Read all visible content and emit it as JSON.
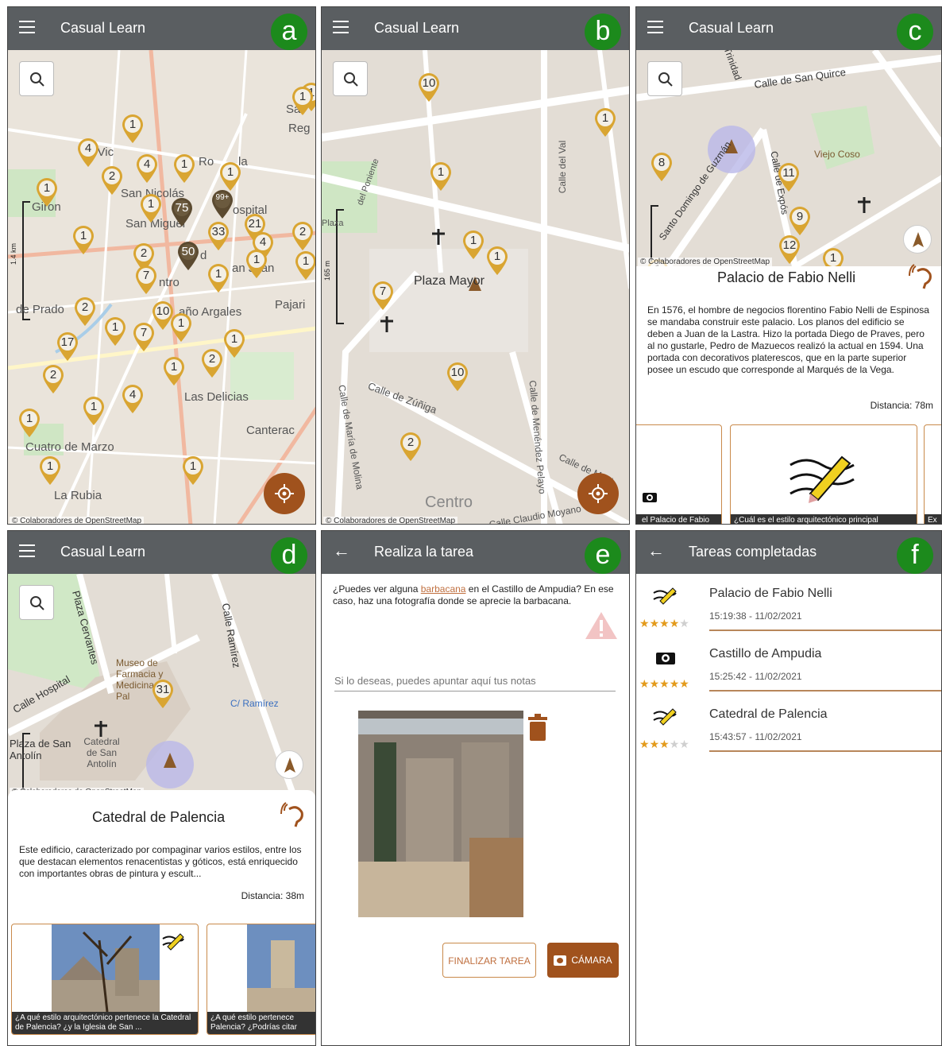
{
  "colors": {
    "appbar": "#5a5e61",
    "badge": "#1c8a1c",
    "accent": "#a0521d",
    "pin": "#d9a532",
    "pin_dark": "#5b4a30"
  },
  "panels": {
    "a": {
      "badge": "a",
      "app_title": "Casual Learn",
      "labels": [
        "Giron",
        "Sa",
        "Reg",
        "a Vic",
        "Ro",
        "la",
        "San Nicolás",
        "San Miguel",
        "ospital",
        "ntro",
        "de Prado",
        "año Argales",
        "Pajari",
        "Las Delicias",
        "Canterac",
        "Cuatro de Marzo",
        "La Rubia",
        "d",
        "an Juan"
      ],
      "pins": [
        "1",
        "4",
        "1",
        "1",
        "4",
        "2",
        "1",
        "1",
        "1",
        "99+",
        "75",
        "1",
        "21",
        "2",
        "33",
        "50",
        "4",
        "1",
        "1",
        "2",
        "7",
        "1",
        "1",
        "2",
        "10",
        "1",
        "17",
        "1",
        "7",
        "1",
        "1",
        "2",
        "1",
        "4",
        "2",
        "1",
        "1",
        "1"
      ],
      "scale_label": "1.4 km",
      "attribution": "© Colaboradores de OpenStreetMap"
    },
    "b": {
      "badge": "b",
      "app_title": "Casual Learn",
      "labels": [
        "Plaza Mayor",
        "Calle del Val",
        "Calle de Zúñiga",
        "Calle de María de Molina",
        "Calle de Menéndez Pelayo",
        "Calle de Mont",
        "Centro",
        "Calle Claudio Moyano",
        "Plaza",
        "del Poniente"
      ],
      "pins": [
        "10",
        "1",
        "1",
        "1",
        "1",
        "7",
        "10",
        "2"
      ],
      "scale_label": "165 m",
      "attribution": "© Colaboradores de OpenStreetMap"
    },
    "c": {
      "badge": "c",
      "app_title": "Casual Learn",
      "labels": [
        "Calle de San Quirce",
        "Viejo Coso",
        "Santo Domingo de Guzmán",
        "Calle de Expós",
        "Trinidad"
      ],
      "pins": [
        "8",
        "11",
        "9",
        "12",
        "1",
        "1"
      ],
      "attribution": "© Colaboradores de OpenStreetMap",
      "card_title": "Palacio de Fabio Nelli",
      "description": "En 1576, el hombre de negocios florentino Fabio Nelli de Espinosa se mandaba construir este palacio. Los planos del edificio se deben a Juan de la Lastra. Hizo la portada Diego de Praves, pero al no gustarle, Pedro de Mazuecos realizó la actual en 1594. Una portada con decorativos platerescos, que en la parte superior posee un escudo que corresponde al Marqués de la Vega.",
      "distance": "Distancia: 78m",
      "thumbs": [
        "el Palacio de Fabio",
        "¿Cuál es el estilo arquitectónico principal",
        "Ex"
      ]
    },
    "d": {
      "badge": "d",
      "app_title": "Casual Learn",
      "labels": [
        "Plaza Cervantes",
        "Calle Ramírez",
        "Calle Hospital",
        "Museo de Farmacia y Medicina de Pal",
        "C/ Ramírez",
        "Plaza de San Antolín",
        "Catedral de San Antolín"
      ],
      "pins": [
        "31"
      ],
      "attribution": "© Colaboradores de OpenStreetMap",
      "card_title": "Catedral de Palencia",
      "description": "Este edificio, caracterizado por compaginar varios estilos, entre los que destacan elementos renacentistas y góticos, está enriquecido con importantes obras de pintura y escult...",
      "distance": "Distancia: 38m",
      "thumbs": [
        "¿A qué estilo arquitectónico pertenece la Catedral de Palencia? ¿y la Iglesia de San ...",
        "¿A qué estilo pertenece Palencia? ¿Podrías citar"
      ]
    },
    "e": {
      "badge": "e",
      "app_title": "Realiza la tarea",
      "question_pre": "¿Puedes ver alguna ",
      "question_link": "barbacana",
      "question_post": " en el Castillo de Ampudia? En ese caso, haz una fotografía donde se aprecie la barbacana.",
      "notes_placeholder": "Si lo deseas, puedes apuntar aquí tus notas",
      "finish_button": "FINALIZAR TAREA",
      "camera_button": "CÁMARA"
    },
    "f": {
      "badge": "f",
      "app_title": "Tareas completadas",
      "tasks": [
        {
          "name": "Palacio de Fabio Nelli",
          "time": "15:19:38 - 11/02/2021",
          "rating": 4,
          "icon": "pen-icon"
        },
        {
          "name": "Castillo de Ampudia",
          "time": "15:25:42 - 11/02/2021",
          "rating": 5,
          "icon": "camera-icon"
        },
        {
          "name": "Catedral de Palencia",
          "time": "15:43:57 - 11/02/2021",
          "rating": 3,
          "icon": "pen-icon"
        }
      ]
    }
  }
}
